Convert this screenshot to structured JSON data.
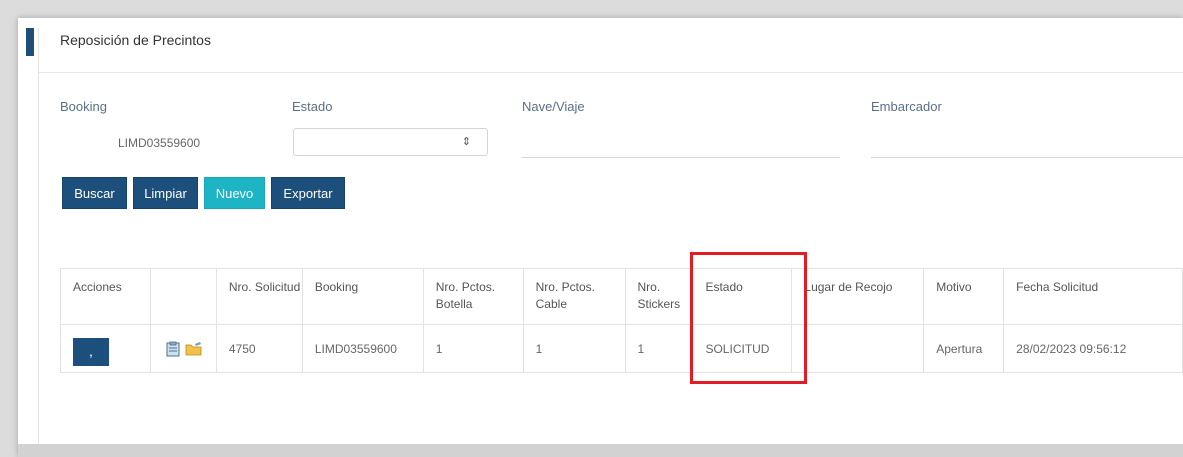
{
  "page": {
    "title": "Reposición de Precintos"
  },
  "filters": {
    "booking_label": "Booking",
    "booking_value": "LIMD03559600",
    "estado_label": "Estado",
    "estado_value": "",
    "nave_label": "Nave/Viaje",
    "nave_value": "",
    "embarcador_label": "Embarcador",
    "embarcador_value": ""
  },
  "actions": {
    "buscar": "Buscar",
    "limpiar": "Limpiar",
    "nuevo": "Nuevo",
    "exportar": "Exportar"
  },
  "table": {
    "headers": {
      "acciones": "Acciones",
      "blank": "",
      "nro_solicitud": "Nro. Solicitud",
      "booking": "Booking",
      "pctos_botella": "Nro. Pctos. Botella",
      "pctos_cable": "Nro. Pctos. Cable",
      "stickers": "Nro. Stickers",
      "estado": "Estado",
      "lugar": "Lugar de Recojo",
      "motivo": "Motivo",
      "fecha": "Fecha Solicitud"
    },
    "rows": [
      {
        "action_label": ",",
        "nro_solicitud": "4750",
        "booking": "LIMD03559600",
        "pctos_botella": "1",
        "pctos_cable": "1",
        "stickers": "1",
        "estado": "SOLICITUD",
        "lugar": "",
        "motivo": "Apertura",
        "fecha": "28/02/2023 09:56:12"
      }
    ]
  },
  "icons": [
    "clipboard-icon",
    "folder-edit-icon",
    "select-arrow-icon"
  ],
  "colors": {
    "primary": "#1c4f7c",
    "teal": "#1db5c6",
    "highlight": "#e31b23"
  }
}
